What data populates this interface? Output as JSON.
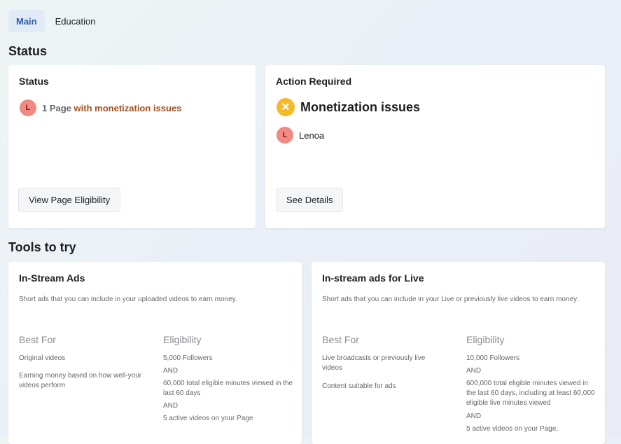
{
  "tabs": [
    {
      "label": "Main"
    },
    {
      "label": "Education"
    }
  ],
  "status_section": {
    "title": "Status"
  },
  "status_card": {
    "title": "Status",
    "avatar_letter": "L",
    "count_text": "1 Page",
    "issue_text": "with monetization issues",
    "button_label": "View Page Eligibility"
  },
  "action_card": {
    "title": "Action Required",
    "heading": "Monetization issues",
    "page_avatar_letter": "L",
    "page_name": "Lenoa",
    "button_label": "See Details"
  },
  "tools_section": {
    "title": "Tools to try"
  },
  "instream_card": {
    "title": "In-Stream Ads",
    "description": "Short ads that you can include in your uploaded videos to earn money.",
    "best_for_heading": "Best For",
    "best_for": [
      "Original videos",
      "Earning money based on how well-your videos perform"
    ],
    "eligibility_heading": "Eligibility",
    "eligibility": [
      "5,000 Followers",
      "AND",
      "60,000 total eligible minutes viewed in the last 60 days",
      "AND",
      "5 active videos on your Page"
    ]
  },
  "live_card": {
    "title": "In-stream ads for Live",
    "description": "Short ads that you can include in your Live or previously live videos to earn money.",
    "best_for_heading": "Best For",
    "best_for": [
      "Live broadcasts or previously live videos",
      "Content suitable for ads"
    ],
    "eligibility_heading": "Eligibility",
    "eligibility": [
      "10,000 Followers",
      "AND",
      "600,000 total eligible minutes viewed in the last 60 days, including at least 60,000 eligible live minutes viewed",
      "AND",
      "5 active videos on your Page,"
    ]
  },
  "colors": {
    "accent": "#2f5fa8",
    "issue_link": "#a7501d",
    "warning": "#f7b928",
    "avatar": "#f08a82"
  }
}
